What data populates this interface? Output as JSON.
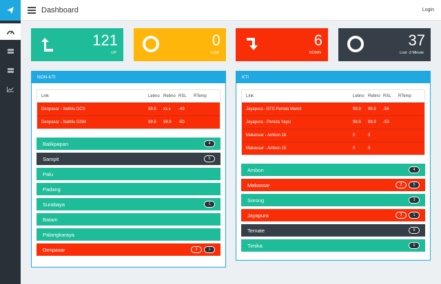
{
  "header": {
    "title": "Dashboard",
    "login": "Login"
  },
  "sidebar": {
    "items": [
      "logo-icon",
      "gauge-icon",
      "list-icon",
      "server-icon",
      "chart-icon"
    ]
  },
  "stats": [
    {
      "value": "121",
      "label": "UP",
      "color": "#1ebc98",
      "icon": "arrow-up-icon"
    },
    {
      "value": "0",
      "label": "LOW",
      "color": "#ffb60a",
      "icon": "ring-icon"
    },
    {
      "value": "6",
      "label": "DOWN",
      "color": "#f92e07",
      "icon": "arrow-down-icon"
    },
    {
      "value": "37",
      "label": "Lost -3 Minute",
      "color": "#363e47",
      "icon": "ring-icon"
    }
  ],
  "columns": {
    "link": "Link",
    "lebno": "Lebno",
    "rebno": "Rebno",
    "rsl": "RSL",
    "rtemp": "RTemp"
  },
  "non_kti": {
    "title": "NON-KTI",
    "rows": [
      {
        "link": "Denpasar - Nalkliu DCS",
        "lebno": "99.9",
        "rebno": "xx.x",
        "rsl": "-49",
        "rtemp": ""
      },
      {
        "link": "Denpasar - Nalkliu GSM",
        "lebno": "99.9",
        "rebno": "99.9",
        "rsl": "-50",
        "rtemp": ""
      }
    ],
    "locations": [
      {
        "name": "Balikpapan",
        "color": "#1ebc98",
        "badges": [
          {
            "text": "4",
            "style": "dark"
          }
        ]
      },
      {
        "name": "Sampit",
        "color": "#363e47",
        "badges": [
          {
            "text": "5",
            "style": "dark"
          }
        ]
      },
      {
        "name": "Palu",
        "color": "#1ebc98",
        "badges": []
      },
      {
        "name": "Padang",
        "color": "#1ebc98",
        "badges": []
      },
      {
        "name": "Surabaya",
        "color": "#1ebc98",
        "badges": [
          {
            "text": "1",
            "style": "dark"
          }
        ]
      },
      {
        "name": "Batam",
        "color": "#1ebc98",
        "badges": []
      },
      {
        "name": "Palangkaraya",
        "color": "#1ebc98",
        "badges": []
      },
      {
        "name": "Denpasar",
        "color": "#f92e07",
        "badges": [
          {
            "text": "2",
            "style": "red"
          },
          {
            "text": "1",
            "style": "dark"
          }
        ]
      }
    ]
  },
  "kti": {
    "title": "KTI",
    "rows": [
      {
        "link": "Jayapura - BTS Pemda Mamit",
        "lebno": "99.9",
        "rebno": "99.9",
        "rsl": "-56",
        "rtemp": ""
      },
      {
        "link": "Jayapura - Pemda Yapsi",
        "lebno": "99.9",
        "rebno": "99.9",
        "rsl": "-53",
        "rtemp": ""
      },
      {
        "link": "Makassar - Ambon 18",
        "lebno": "0",
        "rebno": "0",
        "rsl": "",
        "rtemp": ""
      },
      {
        "link": "Makassar - Ambon 15",
        "lebno": "0",
        "rebno": "0",
        "rsl": "",
        "rtemp": ""
      }
    ],
    "locations": [
      {
        "name": "Ambon",
        "color": "#1ebc98",
        "badges": [
          {
            "text": "4",
            "style": "dark"
          }
        ]
      },
      {
        "name": "Makassar",
        "color": "#f92e07",
        "badges": [
          {
            "text": "2",
            "style": "red"
          },
          {
            "text": "5",
            "style": "dark"
          }
        ]
      },
      {
        "name": "Sorong",
        "color": "#1ebc98",
        "badges": [
          {
            "text": "3",
            "style": "dark"
          }
        ]
      },
      {
        "name": "Jayapura",
        "color": "#f92e07",
        "badges": [
          {
            "text": "2",
            "style": "red"
          },
          {
            "text": "1",
            "style": "dark"
          }
        ]
      },
      {
        "name": "Ternate",
        "color": "#363e47",
        "badges": [
          {
            "text": "8",
            "style": "dark"
          }
        ]
      },
      {
        "name": "Timika",
        "color": "#1ebc98",
        "badges": [
          {
            "text": "5",
            "style": "dark"
          }
        ]
      }
    ]
  }
}
